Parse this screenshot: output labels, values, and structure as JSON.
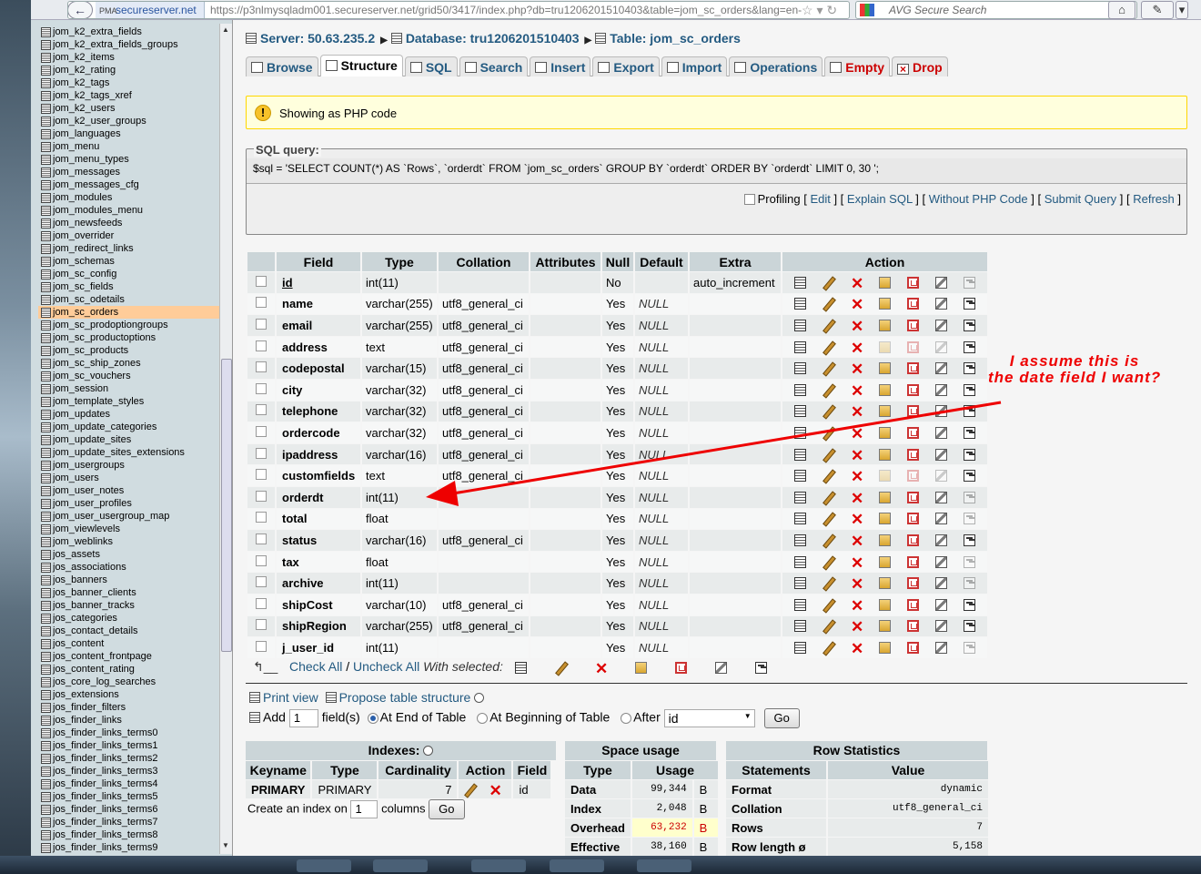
{
  "browser": {
    "site_label": "secureserver.net",
    "site_prefix": "PMA",
    "url": "https://p3nlmysqladm001.secureserver.net/grid50/3417/index.php?db=tru1206201510403&table=jom_sc_orders&lang=en-",
    "search_placeholder": "AVG Secure Search"
  },
  "sidebar": {
    "tables": [
      "jom_k2_extra_fields",
      "jom_k2_extra_fields_groups",
      "jom_k2_items",
      "jom_k2_rating",
      "jom_k2_tags",
      "jom_k2_tags_xref",
      "jom_k2_users",
      "jom_k2_user_groups",
      "jom_languages",
      "jom_menu",
      "jom_menu_types",
      "jom_messages",
      "jom_messages_cfg",
      "jom_modules",
      "jom_modules_menu",
      "jom_newsfeeds",
      "jom_overrider",
      "jom_redirect_links",
      "jom_schemas",
      "jom_sc_config",
      "jom_sc_fields",
      "jom_sc_odetails",
      "jom_sc_orders",
      "jom_sc_prodoptiongroups",
      "jom_sc_productoptions",
      "jom_sc_products",
      "jom_sc_ship_zones",
      "jom_sc_vouchers",
      "jom_session",
      "jom_template_styles",
      "jom_updates",
      "jom_update_categories",
      "jom_update_sites",
      "jom_update_sites_extensions",
      "jom_usergroups",
      "jom_users",
      "jom_user_notes",
      "jom_user_profiles",
      "jom_user_usergroup_map",
      "jom_viewlevels",
      "jom_weblinks",
      "jos_assets",
      "jos_associations",
      "jos_banners",
      "jos_banner_clients",
      "jos_banner_tracks",
      "jos_categories",
      "jos_contact_details",
      "jos_content",
      "jos_content_frontpage",
      "jos_content_rating",
      "jos_core_log_searches",
      "jos_extensions",
      "jos_finder_filters",
      "jos_finder_links",
      "jos_finder_links_terms0",
      "jos_finder_links_terms1",
      "jos_finder_links_terms2",
      "jos_finder_links_terms3",
      "jos_finder_links_terms4",
      "jos_finder_links_terms5",
      "jos_finder_links_terms6",
      "jos_finder_links_terms7",
      "jos_finder_links_terms8",
      "jos_finder_links_terms9"
    ],
    "active": "jom_sc_orders"
  },
  "breadcrumb": {
    "server": "Server: 50.63.235.2",
    "database": "Database: tru1206201510403",
    "table": "Table: jom_sc_orders"
  },
  "tabs": [
    "Browse",
    "Structure",
    "SQL",
    "Search",
    "Insert",
    "Export",
    "Import",
    "Operations",
    "Empty",
    "Drop"
  ],
  "notice": "Showing as PHP code",
  "sql": {
    "legend": "SQL query:",
    "code": "$sql = 'SELECT COUNT(*) AS `Rows`, `orderdt` FROM `jom_sc_orders` GROUP BY `orderdt` ORDER BY `orderdt` LIMIT 0, 30 ';",
    "profiling": "Profiling",
    "links": [
      "Edit",
      "Explain SQL",
      "Without PHP Code",
      "Submit Query",
      "Refresh"
    ]
  },
  "structure": {
    "headers": [
      "Field",
      "Type",
      "Collation",
      "Attributes",
      "Null",
      "Default",
      "Extra",
      "Action"
    ],
    "rows": [
      [
        "id",
        "int(11)",
        "",
        "",
        "No",
        "",
        "auto_increment"
      ],
      [
        "name",
        "varchar(255)",
        "utf8_general_ci",
        "",
        "Yes",
        "NULL",
        ""
      ],
      [
        "email",
        "varchar(255)",
        "utf8_general_ci",
        "",
        "Yes",
        "NULL",
        ""
      ],
      [
        "address",
        "text",
        "utf8_general_ci",
        "",
        "Yes",
        "NULL",
        ""
      ],
      [
        "codepostal",
        "varchar(15)",
        "utf8_general_ci",
        "",
        "Yes",
        "NULL",
        ""
      ],
      [
        "city",
        "varchar(32)",
        "utf8_general_ci",
        "",
        "Yes",
        "NULL",
        ""
      ],
      [
        "telephone",
        "varchar(32)",
        "utf8_general_ci",
        "",
        "Yes",
        "NULL",
        ""
      ],
      [
        "ordercode",
        "varchar(32)",
        "utf8_general_ci",
        "",
        "Yes",
        "NULL",
        ""
      ],
      [
        "ipaddress",
        "varchar(16)",
        "utf8_general_ci",
        "",
        "Yes",
        "NULL",
        ""
      ],
      [
        "customfields",
        "text",
        "utf8_general_ci",
        "",
        "Yes",
        "NULL",
        ""
      ],
      [
        "orderdt",
        "int(11)",
        "",
        "",
        "Yes",
        "NULL",
        ""
      ],
      [
        "total",
        "float",
        "",
        "",
        "Yes",
        "NULL",
        ""
      ],
      [
        "status",
        "varchar(16)",
        "utf8_general_ci",
        "",
        "Yes",
        "NULL",
        ""
      ],
      [
        "tax",
        "float",
        "",
        "",
        "Yes",
        "NULL",
        ""
      ],
      [
        "archive",
        "int(11)",
        "",
        "",
        "Yes",
        "NULL",
        ""
      ],
      [
        "shipCost",
        "varchar(10)",
        "utf8_general_ci",
        "",
        "Yes",
        "NULL",
        ""
      ],
      [
        "shipRegion",
        "varchar(255)",
        "utf8_general_ci",
        "",
        "Yes",
        "NULL",
        ""
      ],
      [
        "j_user_id",
        "int(11)",
        "",
        "",
        "Yes",
        "NULL",
        ""
      ]
    ]
  },
  "with_selected": {
    "check_all": "Check All",
    "separator": "/",
    "uncheck_all": "Uncheck All",
    "label": "With selected:"
  },
  "print_row": {
    "print_view": "Print view",
    "propose": "Propose table structure"
  },
  "add_row": {
    "add": "Add",
    "count": "1",
    "fields": "field(s)",
    "end": "At End of Table",
    "begin": "At Beginning of Table",
    "after": "After",
    "after_field": "id",
    "go": "Go"
  },
  "indexes": {
    "caption": "Indexes:",
    "headers": [
      "Keyname",
      "Type",
      "Cardinality",
      "Action",
      "Field"
    ],
    "row": [
      "PRIMARY",
      "PRIMARY",
      "7",
      "id"
    ],
    "create_label": "Create an index on",
    "create_count": "1",
    "columns": "columns",
    "go": "Go"
  },
  "space": {
    "caption": "Space usage",
    "headers": [
      "Type",
      "Usage"
    ],
    "rows": [
      [
        "Data",
        "99,344",
        "B"
      ],
      [
        "Index",
        "2,048",
        "B"
      ],
      [
        "Overhead",
        "63,232",
        "B"
      ],
      [
        "Effective",
        "38,160",
        "B"
      ]
    ]
  },
  "rowstats": {
    "caption": "Row Statistics",
    "headers": [
      "Statements",
      "Value"
    ],
    "rows": [
      [
        "Format",
        "dynamic"
      ],
      [
        "Collation",
        "utf8_general_ci"
      ],
      [
        "Rows",
        "7"
      ],
      [
        "Row length ø",
        "5,158"
      ]
    ]
  },
  "annotation": "I assume this is\nthe date field I want?",
  "colors": {
    "link": "#235a81",
    "annotation": "#e00000",
    "active_table": "#ffcc99",
    "header": "#cbd5d8"
  }
}
